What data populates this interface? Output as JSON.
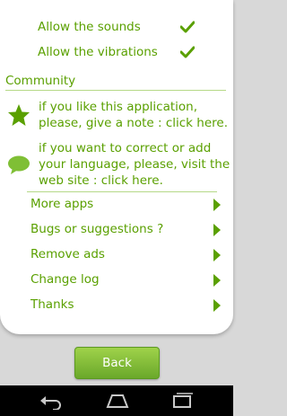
{
  "settings": [
    {
      "label": "Allow the sounds",
      "checked": true
    },
    {
      "label": "Allow the vibrations",
      "checked": true
    }
  ],
  "community": {
    "header": "Community",
    "items": [
      {
        "icon": "star-icon",
        "text": "if you like this application, please, give a note : click here."
      },
      {
        "icon": "speech-bubble-icon",
        "text": "if you want to correct or add your language, please, visit the web site : click here."
      }
    ]
  },
  "menu": [
    {
      "label": "More apps"
    },
    {
      "label": "Bugs or suggestions ?"
    },
    {
      "label": "Remove ads"
    },
    {
      "label": "Change log"
    },
    {
      "label": "Thanks"
    }
  ],
  "footer": {
    "back_label": "Back"
  },
  "navbar": {
    "buttons": [
      "back-nav-icon",
      "home-nav-icon",
      "recent-apps-icon"
    ]
  },
  "colors": {
    "accent": "#5aa000",
    "button": "#7fbf35",
    "divider": "#b6d988"
  }
}
